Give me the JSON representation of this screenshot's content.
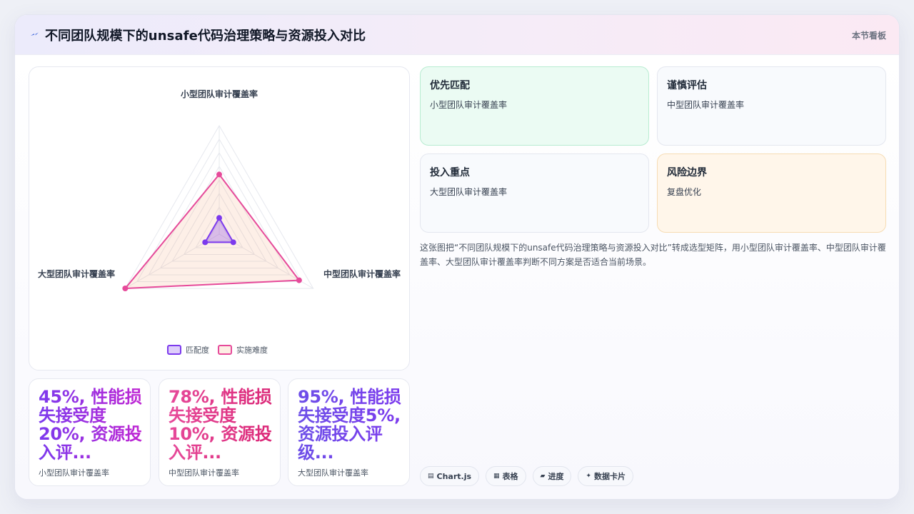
{
  "header": {
    "title": "不同团队规模下的unsafe代码治理策略与资源投入对比",
    "tag": "本节看板"
  },
  "chart_data": {
    "type": "radar",
    "axes": [
      "小型团队审计覆盖率",
      "中型团队审计覆盖率",
      "大型团队审计覆盖率"
    ],
    "series": [
      {
        "name": "匹配度",
        "values": [
          15,
          15,
          15
        ],
        "color": "#7c3aed"
      },
      {
        "name": "实施难度",
        "values": [
          55,
          85,
          100
        ],
        "color": "#e64a9a"
      }
    ],
    "rmax": 100,
    "rings": 8,
    "legend_position": "bottom"
  },
  "metrics": [
    {
      "value": "45%, 性能损失接受度20%, 资源投入评...",
      "label": "小型团队审计覆盖率",
      "gradient": [
        "#7c3aed",
        "#c026d3"
      ]
    },
    {
      "value": "78%, 性能损失接受度10%, 资源投入评...",
      "label": "中型团队审计覆盖率",
      "gradient": [
        "#e64a9a",
        "#db2777"
      ]
    },
    {
      "value": "95%, 性能损失接受度5%, 资源投入评级...",
      "label": "大型团队审计覆盖率",
      "gradient": [
        "#6d4fe8",
        "#7c3aed"
      ]
    }
  ],
  "options": [
    {
      "title": "优先匹配",
      "subtitle": "小型团队审计覆盖率",
      "bg": "#ebfbf3",
      "border": "#b8ecd1"
    },
    {
      "title": "谨慎评估",
      "subtitle": "中型团队审计覆盖率",
      "bg": "#f8fafd",
      "border": "#e4e7ef"
    },
    {
      "title": "投入重点",
      "subtitle": "大型团队审计覆盖率",
      "bg": "#f8fafd",
      "border": "#e4e7ef"
    },
    {
      "title": "风险边界",
      "subtitle": "复盘优化",
      "bg": "#fff6ea",
      "border": "#f6dcb4"
    }
  ],
  "description": "这张图把“不同团队规模下的unsafe代码治理策略与资源投入对比”转成选型矩阵，用小型团队审计覆盖率、中型团队审计覆盖率、大型团队审计覆盖率判断不同方案是否适合当前场景。",
  "chips": [
    {
      "icon": "▤",
      "icon_name": "chart-icon",
      "label": "Chart.js"
    },
    {
      "icon": "▦",
      "icon_name": "table-icon",
      "label": "表格"
    },
    {
      "icon": "▰",
      "icon_name": "progress-icon",
      "label": "进度"
    },
    {
      "icon": "✦",
      "icon_name": "sparkle-icon",
      "label": "数据卡片"
    }
  ]
}
